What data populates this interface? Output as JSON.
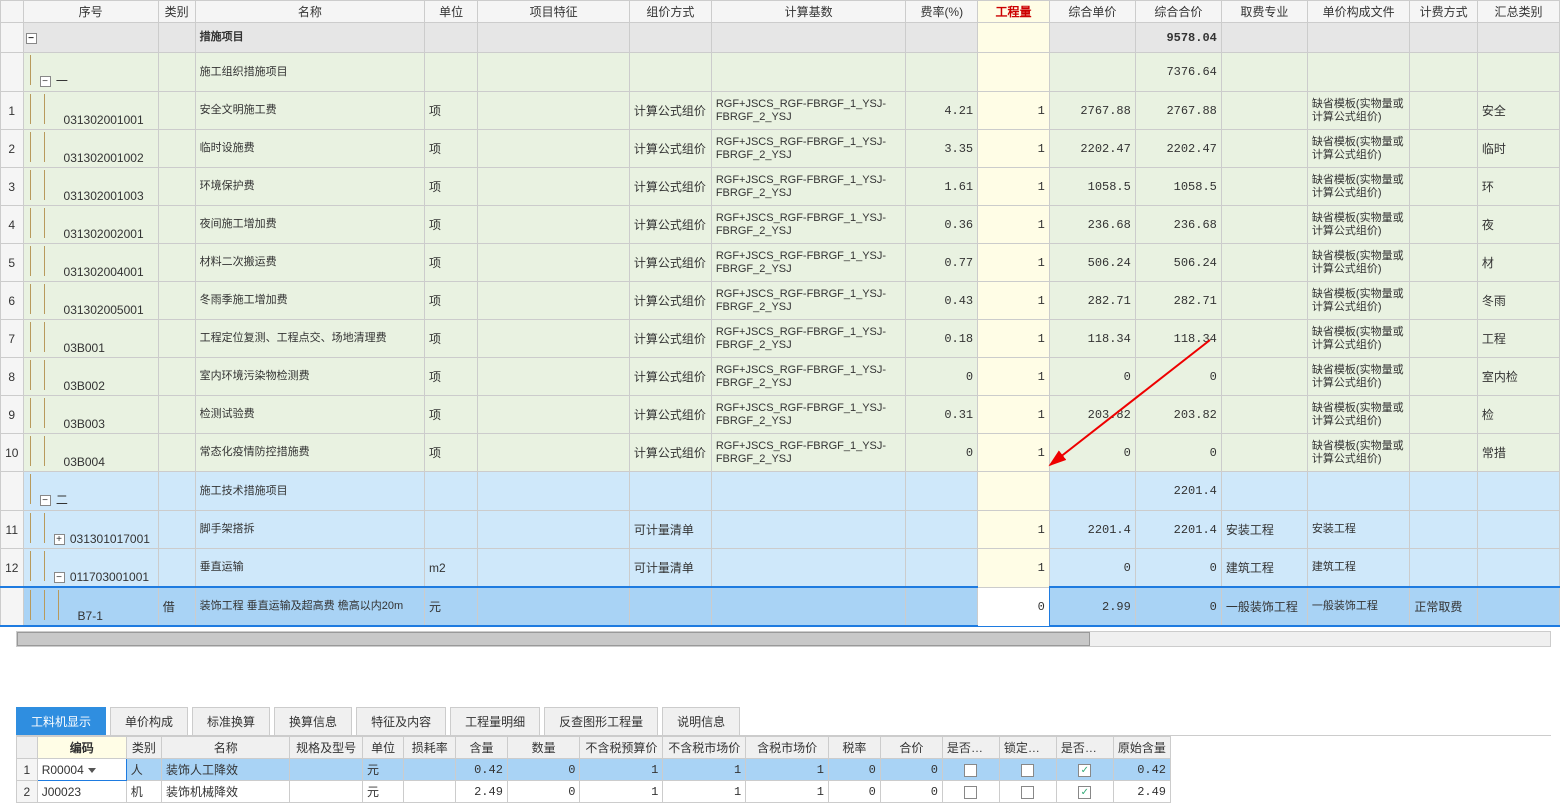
{
  "main_headers": [
    "",
    "序号",
    "类别",
    "名称",
    "单位",
    "项目特征",
    "组价方式",
    "计算基数",
    "费率(%)",
    "工程量",
    "综合单价",
    "综合合价",
    "取费专业",
    "单价构成文件",
    "计费方式",
    "汇总类别"
  ],
  "rows": [
    {
      "rn": "",
      "tree": "minus",
      "seq": "",
      "cat": "",
      "name": "措施项目",
      "unit": "",
      "feat": "",
      "mode": "",
      "base": "",
      "rate": "",
      "qty": "",
      "price": "",
      "total": "9578.04",
      "prof": "",
      "file": "",
      "fee": "",
      "sum": "",
      "cls": "header-row"
    },
    {
      "rn": "",
      "tree": "minus2",
      "seq": "一",
      "cat": "",
      "name": "施工组织措施项目",
      "unit": "",
      "feat": "",
      "mode": "",
      "base": "",
      "rate": "",
      "qty": "",
      "price": "",
      "total": "7376.64",
      "prof": "",
      "file": "",
      "fee": "",
      "sum": "",
      "cls": "row-green"
    },
    {
      "rn": "1",
      "tree": "leaf",
      "seq": "031302001001",
      "cat": "",
      "name": "安全文明施工费",
      "unit": "项",
      "feat": "",
      "mode": "计算公式组价",
      "base": "RGF+JSCS_RGF-FBRGF_1_YSJ-FBRGF_2_YSJ",
      "rate": "4.21",
      "qty": "1",
      "price": "2767.88",
      "total": "2767.88",
      "prof": "",
      "file": "缺省模板(实物量或计算公式组价)",
      "fee": "",
      "sum": "安全",
      "cls": "row-green"
    },
    {
      "rn": "2",
      "tree": "leaf",
      "seq": "031302001002",
      "cat": "",
      "name": "临时设施费",
      "unit": "项",
      "feat": "",
      "mode": "计算公式组价",
      "base": "RGF+JSCS_RGF-FBRGF_1_YSJ-FBRGF_2_YSJ",
      "rate": "3.35",
      "qty": "1",
      "price": "2202.47",
      "total": "2202.47",
      "prof": "",
      "file": "缺省模板(实物量或计算公式组价)",
      "fee": "",
      "sum": "临时",
      "cls": "row-green"
    },
    {
      "rn": "3",
      "tree": "leaf",
      "seq": "031302001003",
      "cat": "",
      "name": "环境保护费",
      "unit": "项",
      "feat": "",
      "mode": "计算公式组价",
      "base": "RGF+JSCS_RGF-FBRGF_1_YSJ-FBRGF_2_YSJ",
      "rate": "1.61",
      "qty": "1",
      "price": "1058.5",
      "total": "1058.5",
      "prof": "",
      "file": "缺省模板(实物量或计算公式组价)",
      "fee": "",
      "sum": "环",
      "cls": "row-green"
    },
    {
      "rn": "4",
      "tree": "leaf",
      "seq": "031302002001",
      "cat": "",
      "name": "夜间施工增加费",
      "unit": "项",
      "feat": "",
      "mode": "计算公式组价",
      "base": "RGF+JSCS_RGF-FBRGF_1_YSJ-FBRGF_2_YSJ",
      "rate": "0.36",
      "qty": "1",
      "price": "236.68",
      "total": "236.68",
      "prof": "",
      "file": "缺省模板(实物量或计算公式组价)",
      "fee": "",
      "sum": "夜",
      "cls": "row-green"
    },
    {
      "rn": "5",
      "tree": "leaf",
      "seq": "031302004001",
      "cat": "",
      "name": "材料二次搬运费",
      "unit": "项",
      "feat": "",
      "mode": "计算公式组价",
      "base": "RGF+JSCS_RGF-FBRGF_1_YSJ-FBRGF_2_YSJ",
      "rate": "0.77",
      "qty": "1",
      "price": "506.24",
      "total": "506.24",
      "prof": "",
      "file": "缺省模板(实物量或计算公式组价)",
      "fee": "",
      "sum": "材",
      "cls": "row-green"
    },
    {
      "rn": "6",
      "tree": "leaf",
      "seq": "031302005001",
      "cat": "",
      "name": "冬雨季施工增加费",
      "unit": "项",
      "feat": "",
      "mode": "计算公式组价",
      "base": "RGF+JSCS_RGF-FBRGF_1_YSJ-FBRGF_2_YSJ",
      "rate": "0.43",
      "qty": "1",
      "price": "282.71",
      "total": "282.71",
      "prof": "",
      "file": "缺省模板(实物量或计算公式组价)",
      "fee": "",
      "sum": "冬雨",
      "cls": "row-green"
    },
    {
      "rn": "7",
      "tree": "leaf",
      "seq": "03B001",
      "cat": "",
      "name": "工程定位复测、工程点交、场地清理费",
      "unit": "项",
      "feat": "",
      "mode": "计算公式组价",
      "base": "RGF+JSCS_RGF-FBRGF_1_YSJ-FBRGF_2_YSJ",
      "rate": "0.18",
      "qty": "1",
      "price": "118.34",
      "total": "118.34",
      "prof": "",
      "file": "缺省模板(实物量或计算公式组价)",
      "fee": "",
      "sum": "工程",
      "cls": "row-green"
    },
    {
      "rn": "8",
      "tree": "leaf",
      "seq": "03B002",
      "cat": "",
      "name": "室内环境污染物检测费",
      "unit": "项",
      "feat": "",
      "mode": "计算公式组价",
      "base": "RGF+JSCS_RGF-FBRGF_1_YSJ-FBRGF_2_YSJ",
      "rate": "0",
      "qty": "1",
      "price": "0",
      "total": "0",
      "prof": "",
      "file": "缺省模板(实物量或计算公式组价)",
      "fee": "",
      "sum": "室内检",
      "cls": "row-green"
    },
    {
      "rn": "9",
      "tree": "leaf",
      "seq": "03B003",
      "cat": "",
      "name": "检测试验费",
      "unit": "项",
      "feat": "",
      "mode": "计算公式组价",
      "base": "RGF+JSCS_RGF-FBRGF_1_YSJ-FBRGF_2_YSJ",
      "rate": "0.31",
      "qty": "1",
      "price": "203.82",
      "total": "203.82",
      "prof": "",
      "file": "缺省模板(实物量或计算公式组价)",
      "fee": "",
      "sum": "检",
      "cls": "row-green"
    },
    {
      "rn": "10",
      "tree": "leaf",
      "seq": "03B004",
      "cat": "",
      "name": "常态化疫情防控措施费",
      "unit": "项",
      "feat": "",
      "mode": "计算公式组价",
      "base": "RGF+JSCS_RGF-FBRGF_1_YSJ-FBRGF_2_YSJ",
      "rate": "0",
      "qty": "1",
      "price": "0",
      "total": "0",
      "prof": "",
      "file": "缺省模板(实物量或计算公式组价)",
      "fee": "",
      "sum": "常措",
      "cls": "row-green"
    },
    {
      "rn": "",
      "tree": "minus2",
      "seq": "二",
      "cat": "",
      "name": "施工技术措施项目",
      "unit": "",
      "feat": "",
      "mode": "",
      "base": "",
      "rate": "",
      "qty": "",
      "price": "",
      "total": "2201.4",
      "prof": "",
      "file": "",
      "fee": "",
      "sum": "",
      "cls": "row-blue"
    },
    {
      "rn": "11",
      "tree": "plus",
      "seq": "031301017001",
      "cat": "",
      "name": "脚手架搭拆",
      "unit": "",
      "feat": "",
      "mode": "可计量清单",
      "base": "",
      "rate": "",
      "qty": "1",
      "price": "2201.4",
      "total": "2201.4",
      "prof": "安装工程",
      "file": "安装工程",
      "fee": "",
      "sum": "",
      "cls": "row-blue"
    },
    {
      "rn": "12",
      "tree": "minus3",
      "seq": "011703001001",
      "cat": "",
      "name": "垂直运输",
      "unit": "m2",
      "feat": "",
      "mode": "可计量清单",
      "base": "",
      "rate": "",
      "qty": "1",
      "price": "0",
      "total": "0",
      "prof": "建筑工程",
      "file": "建筑工程",
      "fee": "",
      "sum": "",
      "cls": "row-blue"
    },
    {
      "rn": "",
      "tree": "leaf2",
      "seq": "B7-1",
      "cat": "借",
      "name": "装饰工程 垂直运输及超高费 檐高以内20m",
      "unit": "元",
      "feat": "",
      "mode": "",
      "base": "",
      "rate": "",
      "qty": "0",
      "price": "2.99",
      "total": "0",
      "prof": "一般装饰工程",
      "file": "一般装饰工程",
      "fee": "正常取费",
      "sum": "",
      "cls": "row-sel",
      "editable_qty": true
    }
  ],
  "tabs": [
    "工料机显示",
    "单价构成",
    "标准换算",
    "换算信息",
    "特征及内容",
    "工程量明细",
    "反查图形工程量",
    "说明信息"
  ],
  "sub_headers": [
    "",
    "编码",
    "类别",
    "名称",
    "规格及型号",
    "单位",
    "损耗率",
    "含量",
    "数量",
    "不含税预算价",
    "不含税市场价",
    "含税市场价",
    "税率",
    "合价",
    "是否暂估",
    "锁定数量",
    "是否计价",
    "原始含量"
  ],
  "sub_rows": [
    {
      "rn": "1",
      "code": "R00004",
      "cat": "人",
      "name": "装饰人工降效",
      "spec": "",
      "unit": "元",
      "loss": "",
      "qty": "0.42",
      "num": "0",
      "bp": "1",
      "mp": "1",
      "tp": "1",
      "tax": "0",
      "tot": "0",
      "tmp": false,
      "lock": false,
      "price": true,
      "orig": "0.42",
      "sel": true,
      "dd": true
    },
    {
      "rn": "2",
      "code": "J00023",
      "cat": "机",
      "name": "装饰机械降效",
      "spec": "",
      "unit": "元",
      "loss": "",
      "qty": "2.49",
      "num": "0",
      "bp": "1",
      "mp": "1",
      "tp": "1",
      "tax": "0",
      "tot": "0",
      "tmp": false,
      "lock": false,
      "price": true,
      "orig": "2.49",
      "sel": false
    }
  ]
}
